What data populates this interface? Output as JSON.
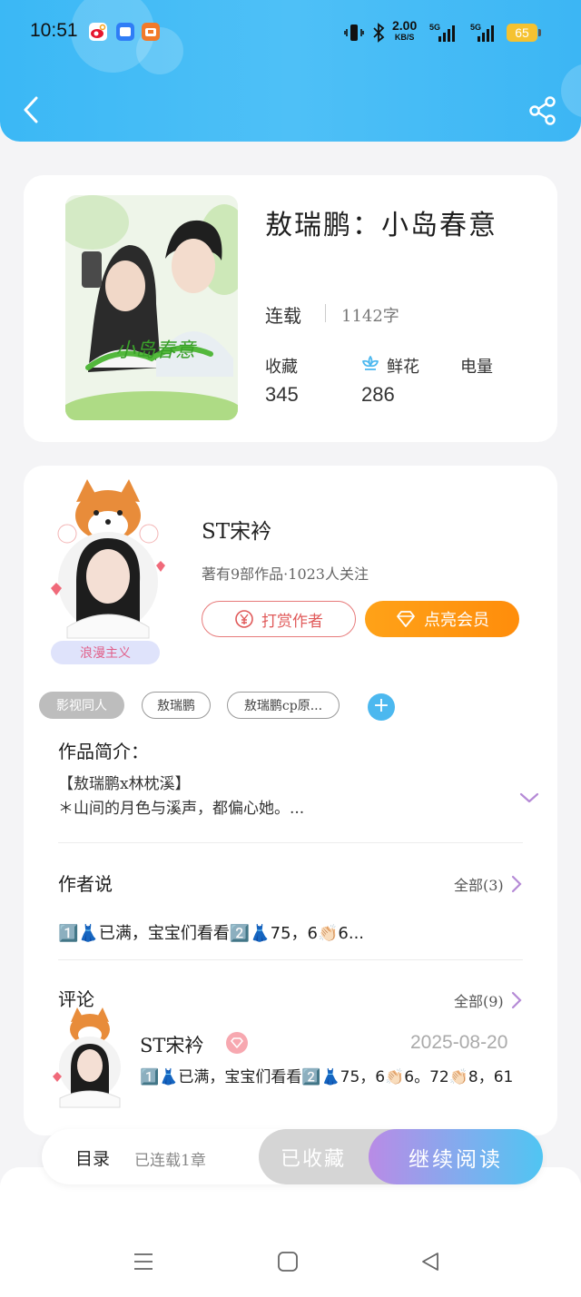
{
  "status_bar": {
    "time": "10:51",
    "net_speed": "2.00",
    "net_unit": "KB/S",
    "sig1": "5G",
    "sig2": "5G",
    "battery": "65"
  },
  "book": {
    "title": "敖瑞鹏：小岛春意",
    "status": "连载",
    "word_count": "1142字",
    "stats": [
      {
        "label": "收藏",
        "value": "345"
      },
      {
        "label": "鲜花",
        "value": "286"
      },
      {
        "label": "电量",
        "value": ""
      }
    ]
  },
  "author": {
    "name": "ST宋衿",
    "meta": "著有9部作品·1023人关注",
    "badge": "浪漫主义",
    "reward_label": "打赏作者",
    "vip_label": "点亮会员"
  },
  "tags": [
    "影视同人",
    "敖瑞鹏",
    "敖瑞鹏cp原..."
  ],
  "intro": {
    "title": "作品简介：",
    "line1": "【敖瑞鹏x林枕溪】",
    "line2": "＊山间的月色与溪声，都偏心她。..."
  },
  "author_says": {
    "title": "作者说",
    "more": "全部(3)",
    "text": "1️⃣👗已满，宝宝们看看2️⃣👗75，6👏🏻6..."
  },
  "comments": {
    "title": "评论",
    "more": "全部(9)",
    "items": [
      {
        "name": "ST宋衿",
        "date": "2025-08-20",
        "text": "1️⃣👗已满，宝宝们看看2️⃣👗75，6👏🏻6。72👏🏻8，61"
      }
    ]
  },
  "bottom": {
    "toc": "目录",
    "toc_sub": "已连载1章",
    "collected": "已收藏",
    "continue": "继续阅读"
  },
  "colors": {
    "header": "#3bb8f5",
    "accent_orange": "#ff9614",
    "accent_red": "#e05a5a",
    "accent_blue": "#4cb8ef",
    "purple": "#b98be6"
  }
}
